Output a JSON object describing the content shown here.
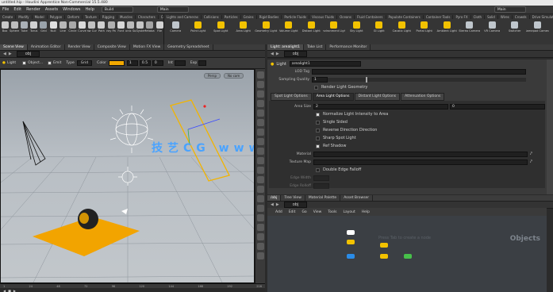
{
  "app": {
    "title": "untitled.hip - Houdini Apprentice Non-Commercial 15.5.480"
  },
  "menubar": {
    "items": [
      "File",
      "Edit",
      "Render",
      "Assets",
      "Windows",
      "Help"
    ],
    "desktop_left": "Build",
    "desktop_center": "Main",
    "desktop_right": "Main"
  },
  "shelf_left": {
    "tabs": [
      "Create",
      "Modify",
      "Model",
      "Polygon",
      "Deform",
      "Texture",
      "Rigging",
      "Muscles",
      "Characters",
      "Constraints",
      "Hair Utils",
      "Guide Process",
      "Guide Brushes",
      "Terrain FX",
      "Cloud FX",
      "Volume"
    ],
    "tools": [
      "Box",
      "Sphere",
      "Tube",
      "Torus",
      "Grid",
      "Null",
      "Line",
      "Circle",
      "Curve",
      "Draw Curve",
      "Path",
      "Spray Paint",
      "Font",
      "Platonic Solids",
      "L-System",
      "Metaball",
      "File"
    ]
  },
  "shelf_right": {
    "tabs": [
      "Lights and Cameras",
      "Collisions",
      "Particles",
      "Grains",
      "Rigid Bodies",
      "Particle Fluids",
      "Viscous Fluids",
      "Oceans",
      "Fluid Containers",
      "Populate Containers",
      "Container Tools",
      "Pyro FX",
      "Cloth",
      "Solid",
      "Wires",
      "Crowds",
      "Drive Simulation"
    ],
    "tools": [
      "Camera",
      "Point Light",
      "Spot Light",
      "Area Light",
      "Geometry Light",
      "Volume Light",
      "Distant Light",
      "Environment Light",
      "Sky Light",
      "GI Light",
      "Caustic Light",
      "Portal Light",
      "Ambient Light",
      "Stereo Camera",
      "VR Camera",
      "Switcher",
      "Gamepad Camera"
    ]
  },
  "pane_tabs_left": [
    "Scene View",
    "Animation Editor",
    "Render View",
    "Composite View",
    "Motion FX View",
    "Geometry Spreadsheet"
  ],
  "pane_tabs_right": [
    "Light: arealight1",
    "Take List",
    "Performance Monitor"
  ],
  "viewport": {
    "path": "obj",
    "toolbar": {
      "light_label": "Light",
      "object_label": "Object...",
      "emit_label": "Emit",
      "type_label": "Type",
      "type_value": "Grid",
      "color_label": "Color",
      "color_value": "#f2a900",
      "r_value": "1",
      "g_value": "0.5",
      "b_value": "0",
      "intensity_label": "Int",
      "exposure_label": "Exp"
    },
    "persp_button": "Persp",
    "cam_button": "No cam",
    "watermark": "技艺CG  www.qdnxxb.cn"
  },
  "param_pane": {
    "node_type": "Light",
    "node_name": "arealight1",
    "rows_top": [
      {
        "label": "LOD Tag",
        "value": ""
      },
      {
        "label": "Sampling Quality",
        "value": "1"
      }
    ],
    "render_light_geometry": "Render Light Geometry",
    "tabs": [
      "Spot Light Options",
      "Area Light Options",
      "Distant Light Options",
      "Attenuation Options"
    ],
    "active_tab": 1,
    "area_size_label": "Area Size",
    "area_size_x": "2",
    "area_size_y": "0",
    "options": [
      {
        "label": "Normalize Light Intensity to Area",
        "checked": true
      },
      {
        "label": "Single Sided",
        "checked": false
      },
      {
        "label": "Reverse Direction Direction",
        "checked": false
      },
      {
        "label": "Sharp Spot Light",
        "checked": false
      },
      {
        "label": "Ref Shadow",
        "checked": true
      }
    ],
    "material_label": "Material",
    "texture_map_label": "Texture Map",
    "double_edge_label": "Double Edge Falloff",
    "edge_width_label": "Edge Width",
    "edge_rolloff_label": "Edge Rolloff"
  },
  "network": {
    "tabs": [
      "/obj",
      "Tree View",
      "Material Palette",
      "Asset Browser"
    ],
    "path": "obj",
    "menu": [
      "Add",
      "Edit",
      "Go",
      "View",
      "Tools",
      "Layout",
      "Help"
    ],
    "context_label": "Objects",
    "ghost_text": "Press Tab to create a node"
  },
  "timeline": {
    "ticks": [
      "1",
      "24",
      "48",
      "72",
      "96",
      "120",
      "144",
      "168",
      "192",
      "216"
    ]
  }
}
